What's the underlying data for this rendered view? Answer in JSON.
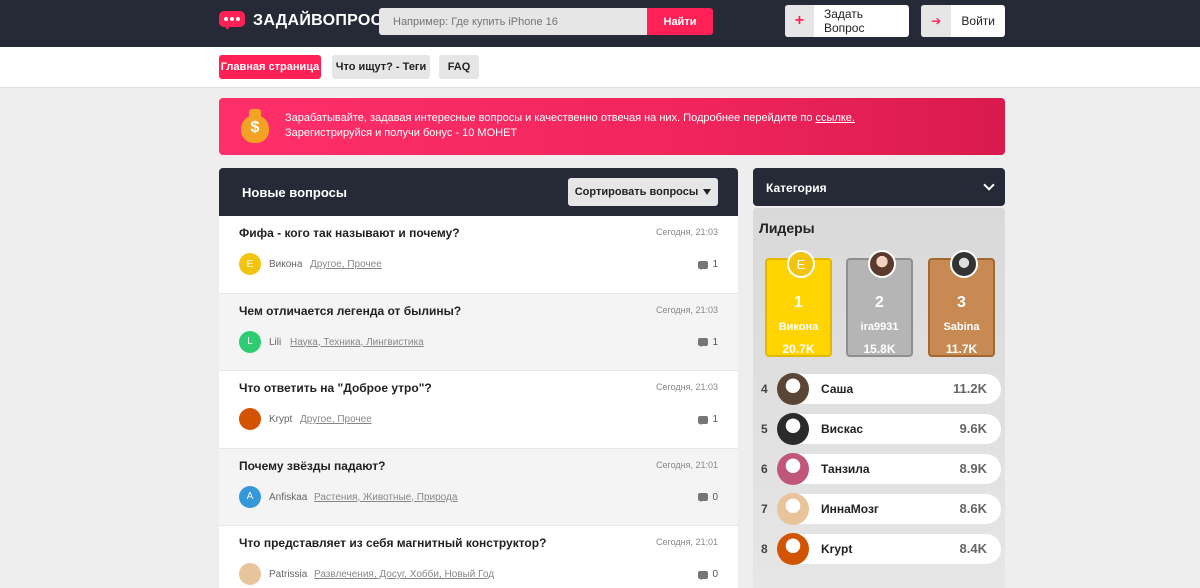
{
  "header": {
    "logo_text": "ЗАДАЙВОПРОС",
    "search_placeholder": "Например: Где купить iPhone 16",
    "search_button": "Найти",
    "ask_button": "Задать Вопрос",
    "ask_icon": "+",
    "login_button": "Войти",
    "login_icon": "➔"
  },
  "nav": {
    "tabs": [
      {
        "label": "Главная страница",
        "active": true
      },
      {
        "label": "Что ищут? - Теги",
        "active": false
      },
      {
        "label": "FAQ",
        "active": false
      }
    ]
  },
  "banner": {
    "line1": "Зарабатывайте, задавая интересные вопросы и качественно отвечая на них. Подробнее перейдите по ",
    "link": "ссылке.",
    "line2": "Зарегистрируйся и получи бонус - 10 МОНЕТ",
    "icon_symbol": "$"
  },
  "questions": {
    "title": "Новые вопросы",
    "sort_button": "Сортировать вопросы",
    "items": [
      {
        "title": "Фифа - кого так называют и почему?",
        "time": "Сегодня, 21:03",
        "author": "Викона",
        "avatar_letter": "E",
        "avatar_color": "#f2c40e",
        "tags": "Другое, Прочее",
        "answers": "1"
      },
      {
        "title": "Чем отличается легенда от былины?",
        "time": "Сегодня, 21:03",
        "author": "Lili",
        "avatar_letter": "L",
        "avatar_color": "#2ecc71",
        "tags": "Наука, Техника, Лингвистика",
        "answers": "1"
      },
      {
        "title": "Что ответить на \"Доброе утро\"?",
        "time": "Сегодня, 21:03",
        "author": "Krypt",
        "avatar_letter": "",
        "avatar_color": "#d35400",
        "tags": "Другое, Прочее",
        "answers": "1"
      },
      {
        "title": "Почему звёзды падают?",
        "time": "Сегодня, 21:01",
        "author": "Anfiskaa",
        "avatar_letter": "A",
        "avatar_color": "#3498db",
        "tags": "Растения, Животные, Природа",
        "answers": "0"
      },
      {
        "title": "Что представляет из себя магнитный конструктор?",
        "time": "Сегодня, 21:01",
        "author": "Patrissia",
        "avatar_letter": "",
        "avatar_color": "#e8c49a",
        "tags": "Развлечения, Досуг, Хобби, Новый Год",
        "answers": "0"
      }
    ]
  },
  "sidebar": {
    "category_title": "Категория",
    "leaders_title": "Лидеры",
    "podium": [
      {
        "rank": "1",
        "name": "Викона",
        "score": "20.7K",
        "avatar_letter": "E"
      },
      {
        "rank": "2",
        "name": "ira9931",
        "score": "15.8K",
        "avatar_letter": ""
      },
      {
        "rank": "3",
        "name": "Sabina",
        "score": "11.7K",
        "avatar_letter": ""
      }
    ],
    "list": [
      {
        "rank": "4",
        "name": "Саша",
        "score": "11.2K",
        "avatar_color": "#5a4634"
      },
      {
        "rank": "5",
        "name": "Вискас",
        "score": "9.6K",
        "avatar_color": "#2b2b2b"
      },
      {
        "rank": "6",
        "name": "Танзила",
        "score": "8.9K",
        "avatar_color": "#c0567a"
      },
      {
        "rank": "7",
        "name": "ИннаМозг",
        "score": "8.6K",
        "avatar_color": "#e9c49b"
      },
      {
        "rank": "8",
        "name": "Krypt",
        "score": "8.4K",
        "avatar_color": "#d35400"
      }
    ]
  }
}
